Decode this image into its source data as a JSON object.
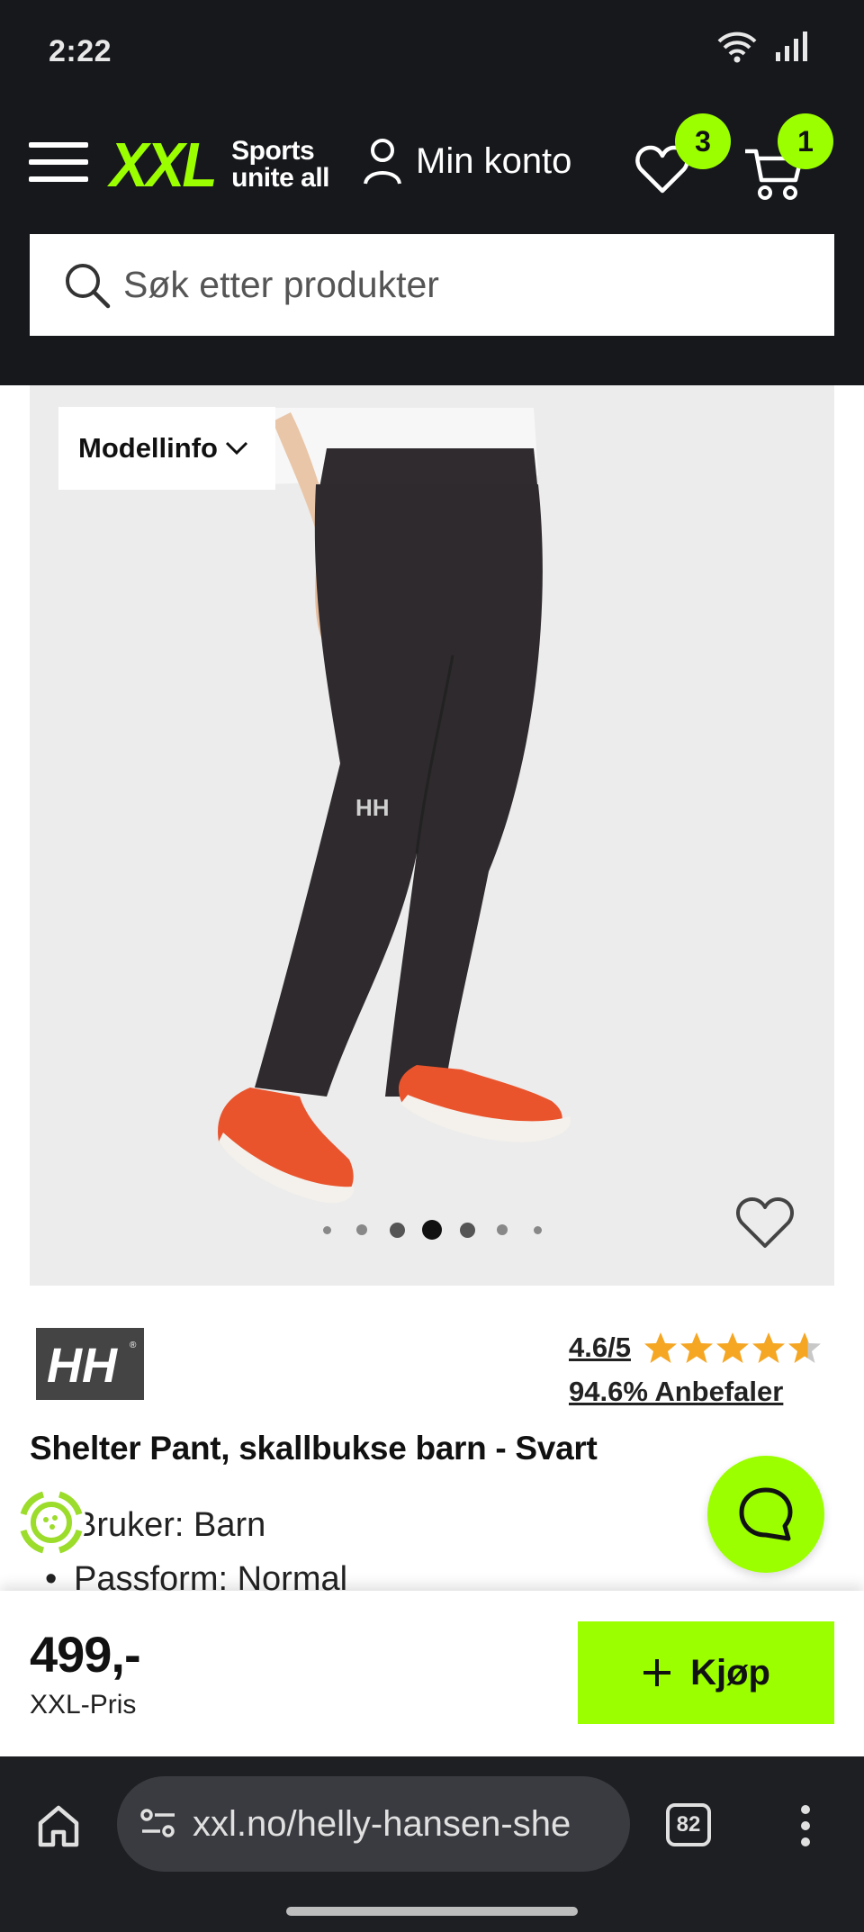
{
  "status_bar": {
    "time": "2:22"
  },
  "header": {
    "logo_main": "XXL",
    "logo_tagline_1": "Sports",
    "logo_tagline_2": "unite all",
    "account_label": "Min konto",
    "wishlist_count": "3",
    "cart_count": "1"
  },
  "search": {
    "placeholder": "Søk etter produkter"
  },
  "gallery": {
    "model_info_label": "Modellinfo",
    "image_logo_text": "HH",
    "active_image_index": 3,
    "image_count": 7
  },
  "product": {
    "brand": "HH",
    "rating": "4.6/5",
    "rating_value": 4.6,
    "rating_max": 5,
    "recommend": "94.6% Anbefaler",
    "title": "Shelter Pant, skallbukse barn - Svart",
    "features": [
      "Bruker: Barn",
      "Passform: Normal"
    ]
  },
  "purchase": {
    "price": "499,-",
    "price_label": "XXL-Pris",
    "buy_label": "Kjøp"
  },
  "browser": {
    "url": "xxl.no/helly-hansen-she",
    "tab_count": "82"
  },
  "colors": {
    "accent": "#9cff00",
    "header_bg": "#17181c",
    "star": "#f5a623"
  }
}
